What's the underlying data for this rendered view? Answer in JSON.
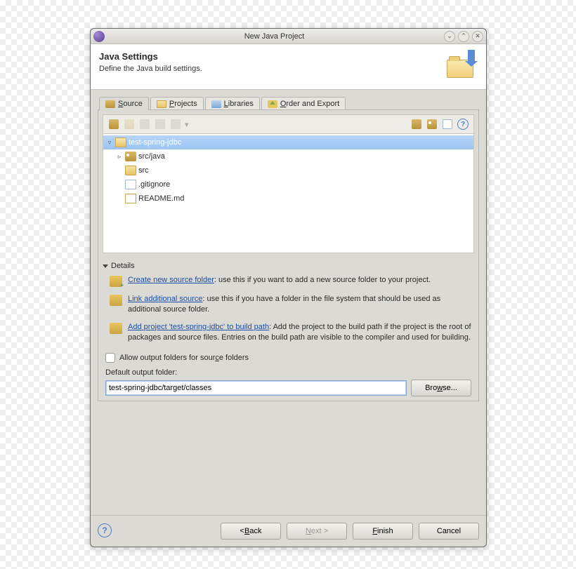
{
  "window": {
    "title": "New Java Project"
  },
  "header": {
    "title": "Java Settings",
    "subtitle": "Define the Java build settings."
  },
  "tabs": {
    "source": "Source",
    "projects": "Projects",
    "libraries": "Libraries",
    "order": "Order and Export"
  },
  "tree": {
    "root": "test-spring-jdbc",
    "n1": "src/java",
    "n2": "src",
    "n3": ".gitignore",
    "n4": "README.md"
  },
  "details": {
    "header": "Details",
    "item1_link": "Create new source folder",
    "item1_rest": ": use this if you want to add a new source folder to your project.",
    "item2_link": "Link additional source",
    "item2_rest": ": use this if you have a folder in the file system that should be used as additional source folder.",
    "item3_link": "Add project 'test-spring-jdbc' to build path",
    "item3_rest": ": Add the project to the build path if the project is the root of packages and source files. Entries on the build path are visible to the compiler and used for building."
  },
  "allow_output_label": "Allow output folders for source folders",
  "output": {
    "label": "Default output folder:",
    "value": "test-spring-jdbc/target/classes",
    "browse": "Browse..."
  },
  "footer": {
    "back": "< Back",
    "next": "Next >",
    "finish": "Finish",
    "cancel": "Cancel"
  },
  "glyphs": {
    "help": "?"
  }
}
